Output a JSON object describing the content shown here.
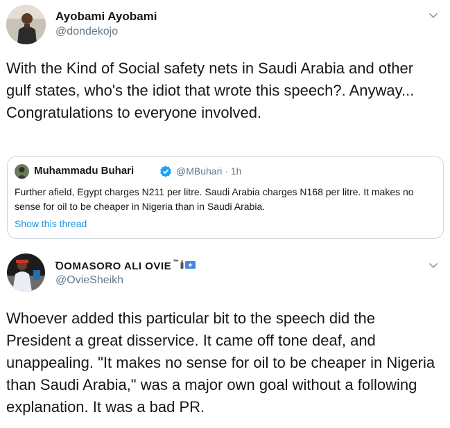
{
  "tweet1": {
    "display_name": "Ayobami Ayobami",
    "handle": "@dondekojo",
    "avatar_icon": "person-avatar-icon",
    "text": "With the Kind of Social safety nets in Saudi Arabia and other gulf states, who's the idiot that wrote this speech?. Anyway... Congratulations to everyone involved.",
    "quoted": {
      "display_name": "Muhammadu Buhari",
      "verified_icon": "verified-badge-icon",
      "meta": "@MBuhari · 1h",
      "text": "Further afield, Egypt charges N211 per litre. Saudi Arabia charges N168 per litre. It makes no sense for oil to be cheaper in Nigeria than in Saudi Arabia.",
      "link": "Show this thread"
    }
  },
  "tweet2": {
    "display_name": "ꝹOMASORO ALI OVIE",
    "name_suffix": "™",
    "handle": "@OvieSheikh",
    "avatar_icon": "person-avatar-icon",
    "text": "Whoever added this particular bit to the speech did the President a great disservice. It came off tone deaf, and unappealing. \"It makes no sense for oil to be cheaper in Nigeria than Saudi Arabia,\" was a major own goal without a following explanation. It was a bad PR."
  },
  "colors": {
    "text": "#14171a",
    "secondary": "#657786",
    "link": "#1b95e0",
    "border": "#ccd6dd",
    "verified": "#1da1f2"
  }
}
